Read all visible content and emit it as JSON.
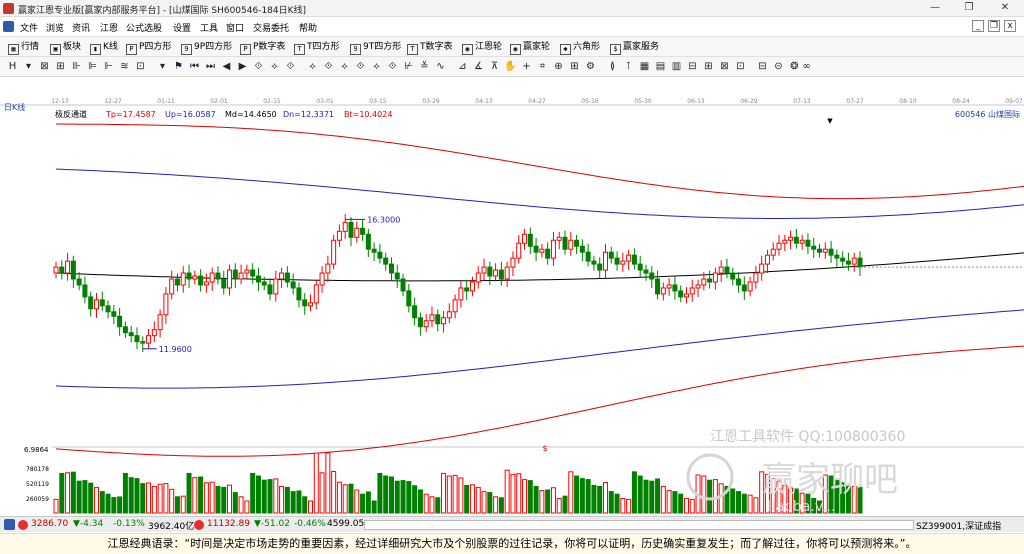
{
  "window": {
    "title": "赢家江恩专业版[赢家内部服务平台] - [山煤国际  SH600546-184日K线]",
    "minimize": "—",
    "restore": "❐",
    "close": "✕"
  },
  "menu": {
    "items": [
      "文件",
      "浏览",
      "资讯",
      "江恩",
      "公式选股",
      "设置",
      "工具",
      "窗口",
      "交易委托",
      "帮助"
    ],
    "mdi": {
      "minimize": "_",
      "restore": "❐",
      "close": "x"
    }
  },
  "toolbar1": {
    "items": [
      {
        "label": "行情",
        "icon": "grid-icon",
        "glyph": "▦"
      },
      {
        "label": "板块",
        "icon": "block-icon",
        "glyph": "▣"
      },
      {
        "label": "K线",
        "icon": "candle-icon",
        "glyph": "▮"
      },
      {
        "label": "P四方形",
        "icon": "p-square-icon",
        "glyph": "P"
      },
      {
        "label": "9P四方形",
        "icon": "9p-square-icon",
        "glyph": "9"
      },
      {
        "label": "P数字表",
        "icon": "p-table-icon",
        "glyph": "P"
      },
      {
        "label": "T四方形",
        "icon": "t-square-icon",
        "glyph": "T"
      },
      {
        "label": "9T四方形",
        "icon": "9t-square-icon",
        "glyph": "9"
      },
      {
        "label": "T数字表",
        "icon": "t-table-icon",
        "glyph": "T"
      },
      {
        "label": "江恩轮",
        "icon": "gann-wheel-icon",
        "glyph": "◉"
      },
      {
        "label": "赢家轮",
        "icon": "winner-wheel-icon",
        "glyph": "◉"
      },
      {
        "label": "六角形",
        "icon": "hexagon-icon",
        "glyph": "✱"
      },
      {
        "label": "赢家服务",
        "icon": "service-icon",
        "glyph": "$"
      }
    ]
  },
  "toolbar2": {
    "glyphs": [
      "H",
      "▾",
      "⊠",
      "⊞",
      "⊪",
      "⊫",
      "⊩",
      "≋",
      "⊡",
      "▾",
      "⚑",
      "⏮",
      "⏭",
      "◀",
      "▶",
      "⟐",
      "⟡",
      "⟐",
      "⟡",
      "⟐",
      "⟡",
      "⟐",
      "⟡",
      "⟐",
      "⊬",
      "≚",
      "∿",
      "⊿",
      "∡",
      "⊼",
      "✋",
      "+",
      "⌗",
      "⊕",
      "⊞",
      "⚙",
      "≬",
      "⊺",
      "▦",
      "▤",
      "▥",
      "⊟",
      "⊞",
      "⊠",
      "⊡",
      "⊟",
      "⊝",
      "❂",
      "∞"
    ]
  },
  "status": {
    "sh_index": "3286.70",
    "sh_change": "▼-4.34",
    "sh_pct": "-0.13%",
    "sh_amount": "3962.40亿",
    "sz_index": "11132.89",
    "sz_change": "▼-51.02",
    "sz_pct": "-0.46%",
    "sz_amount": "4599.05",
    "right_code": "SZ399001,深证成指"
  },
  "quote": "江恩经典语录：“时间是决定市场走势的重要因素，经过详细研究大市及个别股票的过往记录，你将可以证明，历史确实重复发生；而了解过往，你将可以预测将来。”。",
  "colors": {
    "up": "#ff0000",
    "down": "#008000",
    "band_outer": "#e00000",
    "band_inner": "#2020c0",
    "mid": "#000000"
  },
  "chart_data": {
    "type": "candlestick",
    "period_label": "日K线",
    "indicator": {
      "name": "极反通道",
      "tp": "Tp=17.4587",
      "up": "Up=16.0587",
      "md": "Md=14.4650",
      "dn": "Dn=12.3371",
      "bt": "Bt=10.4024"
    },
    "symbol_label": "600546  山煤国际",
    "date_ticks": [
      "12-13",
      "12-27",
      "01-11",
      "02-01",
      "02-15",
      "03-01",
      "03-15",
      "03-29",
      "04-13",
      "04-27",
      "05-16",
      "05-30",
      "06-13",
      "06-29",
      "07-13",
      "07-27",
      "08-10",
      "08-24",
      "09-07"
    ],
    "high_annotation": {
      "label": "16.3000",
      "value": 16.3
    },
    "low_annotation": {
      "label": "11.9600",
      "value": 11.96
    },
    "ylim": [
      8.9,
      19.6
    ],
    "closes": [
      14.7,
      14.5,
      14.9,
      14.3,
      14.1,
      13.7,
      13.3,
      13.6,
      13.4,
      13.2,
      13.05,
      12.7,
      12.5,
      12.4,
      12.2,
      12.15,
      12.4,
      12.6,
      13.1,
      13.8,
      14.3,
      14.1,
      14.5,
      14.3,
      14.4,
      14.1,
      14.2,
      14.5,
      14.3,
      14.0,
      14.6,
      14.3,
      14.5,
      14.6,
      14.4,
      14.2,
      14.1,
      13.8,
      14.3,
      14.5,
      14.2,
      14.0,
      13.6,
      13.4,
      13.5,
      14.1,
      14.5,
      14.8,
      15.6,
      15.9,
      16.2,
      15.7,
      16.0,
      15.8,
      15.3,
      15.2,
      15.0,
      14.8,
      14.5,
      14.3,
      13.9,
      13.4,
      13.0,
      12.7,
      12.9,
      13.1,
      12.8,
      13.0,
      13.2,
      13.6,
      14.0,
      13.9,
      14.2,
      14.5,
      14.7,
      14.4,
      14.6,
      14.3,
      14.7,
      15.0,
      15.5,
      15.8,
      15.4,
      15.2,
      15.3,
      15.0,
      15.6,
      15.7,
      15.3,
      15.6,
      15.4,
      15.2,
      14.9,
      14.8,
      14.6,
      15.2,
      15.0,
      14.8,
      14.9,
      15.1,
      14.8,
      14.6,
      14.5,
      14.3,
      13.8,
      14.0,
      14.1,
      13.9,
      13.7,
      13.8,
      14.0,
      14.1,
      14.3,
      14.2,
      14.5,
      14.7,
      14.5,
      14.3,
      14.1,
      13.9,
      14.2,
      14.5,
      14.8,
      15.1,
      15.3,
      15.5,
      15.6,
      15.7,
      15.5,
      15.6,
      15.4,
      15.3,
      15.2,
      15.3,
      15.1,
      15.0,
      14.9,
      14.8,
      15.0,
      14.7
    ],
    "volume_ticks": [
      "780178",
      "520119",
      "260059"
    ],
    "volume_max": 1040000,
    "volume_top_label": "6.9864"
  },
  "watermark": {
    "line1": "江恩工具软件  QQ:100800360",
    "line2": "赢家聊吧",
    "line3": "liaoba.v..."
  }
}
